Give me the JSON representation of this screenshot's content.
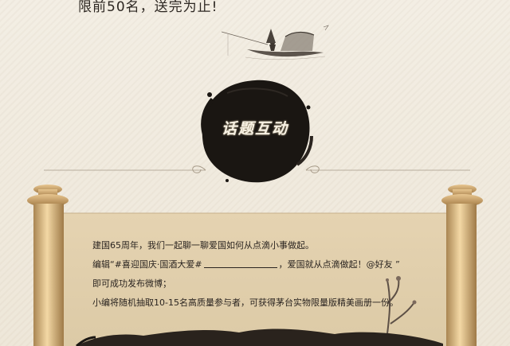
{
  "header": {
    "limit_text": "限前50名，送完为止!"
  },
  "badge": {
    "title": "话题互动"
  },
  "content": {
    "line1": "建国65周年，我们一起聊一聊爱国如何从点滴小事做起。",
    "line2_prefix": "编辑“#喜迎国庆·国酒大爱#",
    "line2_suffix": "，爱国就从点滴做起！@好友 ”",
    "line3": "即可成功发布微博；",
    "line4": "小编将随机抽取10-15名高质量参与者，可获得茅台实物限量版精美画册一份。"
  },
  "colors": {
    "paper": "#f1ebdf",
    "ink": "#1a1612",
    "scroll_rod": "#d9b47a"
  },
  "icons": {
    "boat": "fishing-boat-icon",
    "ink_circle": "ink-splash-icon",
    "plum_branch": "plum-branch-icon"
  }
}
